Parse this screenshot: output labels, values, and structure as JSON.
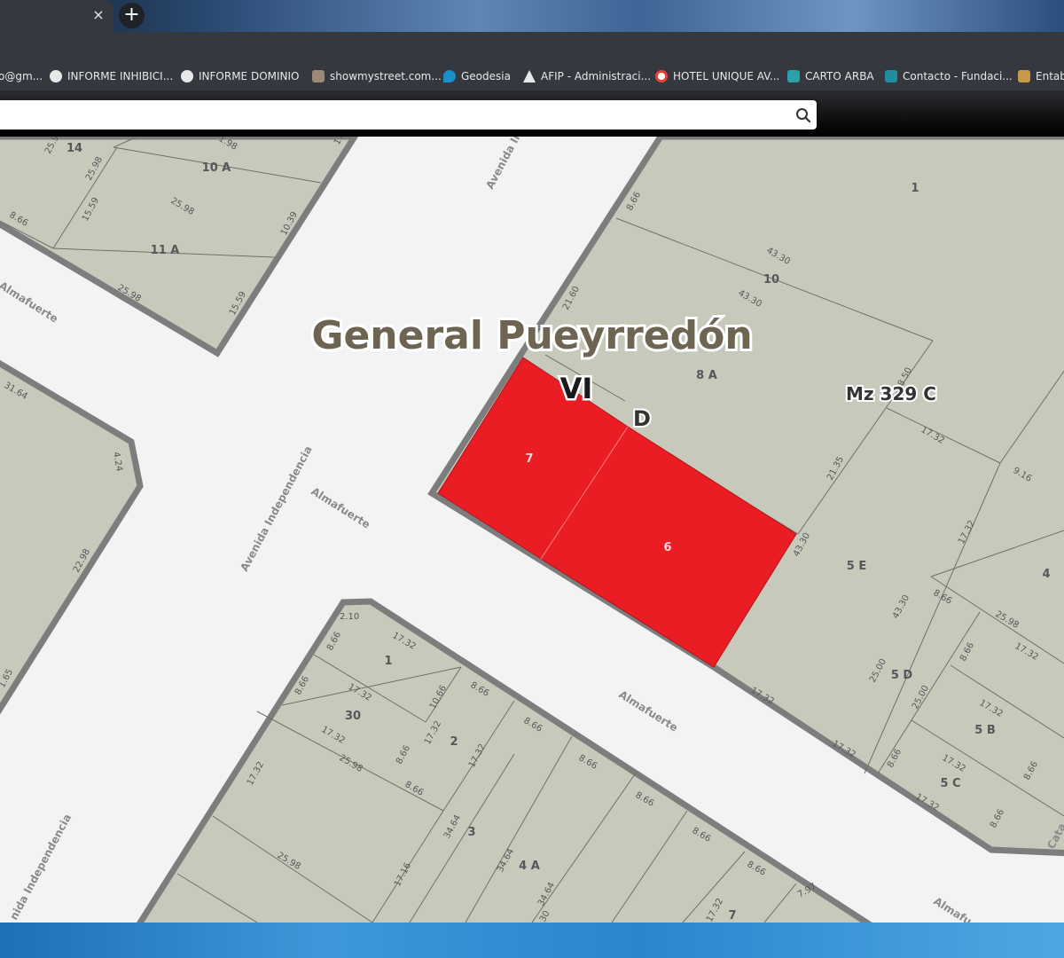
{
  "browser": {
    "tab_close": "×",
    "new_tab": "+",
    "bookmarks": [
      {
        "label": "o@gm...",
        "icon": "gmail-icon",
        "color": "#d9d9d9"
      },
      {
        "label": "INFORME INHIBICI...",
        "icon": "globe-icon",
        "color": "#e8e8e8"
      },
      {
        "label": "INFORME DOMINIO",
        "icon": "globe-icon",
        "color": "#e8e8e8"
      },
      {
        "label": "showmystreet.com...",
        "icon": "image-icon",
        "color": "#9a8a73"
      },
      {
        "label": "Geodesia",
        "icon": "geodesia-icon",
        "color": "#1a8fc9"
      },
      {
        "label": "AFIP - Administraci...",
        "icon": "afip-icon",
        "color": "#e8e8e8"
      },
      {
        "label": "HOTEL UNIQUE AV...",
        "icon": "google-icon",
        "color": "#ea4335"
      },
      {
        "label": "CARTO ARBA",
        "icon": "arba-icon",
        "color": "#2aa0a8"
      },
      {
        "label": "Contacto - Fundaci...",
        "icon": "w-icon",
        "color": "#1f8fa0"
      },
      {
        "label": "Entab",
        "icon": "folder-icon",
        "color": "#c79a4a"
      }
    ]
  },
  "search": {
    "value": "",
    "placeholder": ""
  },
  "map": {
    "title": "General Pueyrredón",
    "circ": "VI",
    "section": "D",
    "manzana": "Mz 329 C",
    "colors": {
      "block": "#c7cabb",
      "street": "#f3f3f3",
      "edge": "#7d7d7d",
      "selected": "#ea1d25"
    },
    "streets": {
      "avenida_top": "Avenida In",
      "almafuerte_left": "Almafuerte",
      "avenida_mid": "Avenida Independencia",
      "almafuerte_center": "Almafuerte",
      "almafuerte_lower": "Almafuerte",
      "avenida_bottom": "nida Independencia",
      "almafuerte_br": "Almafu",
      "cat_edge": "Cata"
    },
    "lots": {
      "l14": "14",
      "l10a": "10 A",
      "l11a": "11 A",
      "r1": "1",
      "r10": "10",
      "r8a": "8 A",
      "r5e": "5 E",
      "r4": "4",
      "r5d": "5 D",
      "r5b": "5 B",
      "r5c": "5 C",
      "sel7": "7",
      "sel6": "6",
      "b1": "1",
      "b30": "30",
      "b2": "2",
      "b3": "3",
      "b4a": "4 A",
      "b7": "7"
    },
    "dims": {
      "tl_a": "25.9",
      "tl_b": "25.98",
      "tl_c": "8.66",
      "tl_d": "15.59",
      "tl_e": "25.98",
      "tl_f": "10.39",
      "tl_g": "25.98",
      "tl_h": "15.59",
      "tl_i": "1.98",
      "tl_j": "17",
      "l_a": "31.64",
      "l_b": "4.24",
      "l_c": "22.98",
      "l_d": "1.65",
      "r_a": "8.66",
      "r_b": "43.30",
      "r_c": "43.30",
      "r_d": "21.60",
      "r_e": "8.50",
      "r_f": "17.32",
      "r_g": "9.16",
      "r_h": "21.35",
      "r_i": "43.30",
      "r_j": "17.32",
      "r_k": "43.30",
      "r_l": "8.66",
      "r_m": "25.98",
      "r_n": "17.32",
      "r_o": "8.66",
      "r_p": "25.00",
      "r_q": "25.00",
      "r_r": "17.32",
      "r_s": "17.32",
      "r_t": "8.66",
      "r_u": "17.32",
      "r_v": "8.66",
      "r_w": "17.32",
      "r_x": "8.66",
      "r_y": "17.32",
      "r_z": "8.66",
      "b_a": "2.10",
      "b_b": "17.32",
      "b_c": "8.66",
      "b_d": "8.66",
      "b_e": "17.32",
      "b_f": "10.66",
      "b_g": "17.32",
      "b_h": "25.98",
      "b_i": "8.66",
      "b_j": "8.66",
      "b_k": "17.32",
      "b_l": "8.66",
      "b_m": "17.32",
      "b_n": "17.32",
      "b_o": "8.66",
      "b_p": "34.64",
      "b_q": "8.66",
      "b_r": "25.98",
      "b_s": "17.16",
      "b_t": "34.64",
      "b_u": "8.66",
      "b_v": "34.64",
      "b_w": "8.66",
      "b_x": "30",
      "b_y": "17.32",
      "b_z": "7.97",
      "b_aa": "8.66"
    }
  }
}
